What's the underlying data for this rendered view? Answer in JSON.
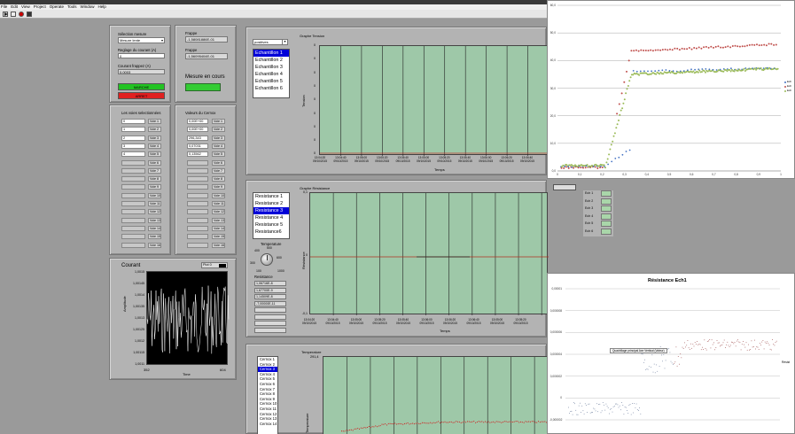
{
  "menu": [
    "File",
    "Edit",
    "View",
    "Project",
    "Operate",
    "Tools",
    "Window",
    "Help"
  ],
  "controls": {
    "selection_label": "Sélection mesure",
    "selection_value": "Mesure lente",
    "reglage_label": "Reglage du courant (A)",
    "reglage_value": "0",
    "courant_label": "Courant frappez (A)",
    "courant_value": "0,0003",
    "marche_label": "MARCHE",
    "arret_label": "ARRET",
    "frappe1_label": "Frappe",
    "frappe1_value": "-1,58081886E-01",
    "frappe2_label": "Frappe",
    "frappe2_value": "-1,56095404E-01",
    "mesure_label": "Mesure en cours"
  },
  "voies": {
    "title": "Les voies selectionnées",
    "rows": [
      {
        "num": "0",
        "name": "Voie 1"
      },
      {
        "num": "1",
        "name": "Voie 2"
      },
      {
        "num": "2",
        "name": "Voie 3"
      },
      {
        "num": "3",
        "name": "Voie 4"
      },
      {
        "num": "4",
        "name": "Voie 5"
      },
      {
        "num": "",
        "name": "Voie 6"
      },
      {
        "num": "",
        "name": "Voie 7"
      },
      {
        "num": "",
        "name": "Voie 8"
      },
      {
        "num": "",
        "name": "Voie 9"
      },
      {
        "num": "",
        "name": "Voie 10"
      },
      {
        "num": "",
        "name": "Voie 11"
      },
      {
        "num": "",
        "name": "Voie 12"
      },
      {
        "num": "",
        "name": "Voie 13"
      },
      {
        "num": "",
        "name": "Voie 14"
      },
      {
        "num": "",
        "name": "Voie 15"
      },
      {
        "num": "",
        "name": "Voie 16"
      }
    ]
  },
  "cernox": {
    "title": "Valeurs du Cernox",
    "rows": [
      {
        "val": "0,00E+00",
        "name": "Voie 1"
      },
      {
        "val": "0,00E+00",
        "name": "Voie 2"
      },
      {
        "val": "296,343",
        "name": "Voie 3"
      },
      {
        "val": "0,07031",
        "name": "Voie 4"
      },
      {
        "val": "0,13562",
        "name": "Voie 5"
      },
      {
        "val": "",
        "name": "Voie 6"
      },
      {
        "val": "",
        "name": "Voie 7"
      },
      {
        "val": "",
        "name": "Voie 8"
      },
      {
        "val": "",
        "name": "Voie 9"
      },
      {
        "val": "",
        "name": "Voie 10"
      },
      {
        "val": "",
        "name": "Voie 11"
      },
      {
        "val": "",
        "name": "Voie 12"
      },
      {
        "val": "",
        "name": "Voie 13"
      },
      {
        "val": "",
        "name": "Voie 14"
      },
      {
        "val": "",
        "name": "Voie 15"
      },
      {
        "val": "",
        "name": "Voie 16"
      }
    ]
  },
  "courant_chart": {
    "title": "Courant",
    "legend": "Plot 0",
    "ylabel": "Amplitude",
    "xlabel": "Time",
    "yticks": [
      "1,0015",
      "1,00145",
      "1,0014",
      "1,00135",
      "1,0013",
      "1,00125",
      "1,0012",
      "1,00115",
      "1,0011"
    ],
    "xticks": [
      "352",
      "604"
    ]
  },
  "temps_graph": {
    "title": "Graphe Tension",
    "selector_value": "positives",
    "ylabel": "Tension",
    "xlabel": "Temps",
    "yticks": [
      "0",
      "0",
      "0",
      "0",
      "0",
      "0",
      "0",
      "0",
      "0"
    ],
    "xticks": [
      "13:04:20\n09/10/2015",
      "13:04:40\n09/10/2015",
      "13:05:00\n09/10/2015",
      "13:05:20\n09/10/2015",
      "13:05:40\n09/10/2015",
      "13:05:00\n09/10/2015",
      "13:05:20\n09/10/2015",
      "13:05:40\n09/10/2015",
      "13:06:00\n09/10/2015",
      "13:06:20\n09/10/2015",
      "13:06:40\n09/10/2015"
    ],
    "items": [
      "Echantillon 1",
      "Echantillon 2",
      "Echantillon 3",
      "Echantillon 4",
      "Echantillon 5",
      "Echantillon 6"
    ],
    "selected": 0
  },
  "resist_graph": {
    "title": "Graphe Résistance",
    "ylabel": "Résistance",
    "xlabel": "Temps",
    "yticks": [
      "0,1",
      "0",
      "-0,1"
    ],
    "xticks": [
      "13:04:20\n09/10/2015",
      "13:04:40\n09/10/2015",
      "13:05:00\n09/10/2015",
      "13:05:20\n09/10/2015",
      "13:05:40\n09/10/2015",
      "13:06:00\n09/10/2015",
      "13:06:20\n09/10/2015",
      "13:06:40\n09/10/2015",
      "13:05:00\n09/10/2015",
      "13:05:20\n09/10/2015"
    ],
    "items": [
      "Resistance 1",
      "Resistance 2",
      "Resistance 3",
      "Resistance 4",
      "Resistance 5",
      "Resistance6"
    ],
    "selected": 2,
    "legend_items": [
      "Ech 1",
      "Ech 2",
      "Ech 3",
      "Ech 4",
      "Ech 5",
      "Ech 6"
    ]
  },
  "temp_knob": {
    "label": "Temperature",
    "ticks": [
      "300",
      "400",
      "500",
      "600",
      "100",
      "1000"
    ],
    "resistance_label": "Resistance",
    "values": [
      "1,06716E-8",
      "1,67700E-9",
      "1,14509E-8",
      "-7,00000E-11"
    ]
  },
  "temp_graph": {
    "title": "Temperature",
    "ylabel": "Temperature",
    "ytick_top": "291,4",
    "items": [
      "Cernox 1",
      "Cernox 2",
      "Cernox 3",
      "Cernox 4",
      "Cernox 5",
      "Cernox 6",
      "Cernox 7",
      "Cernox 8",
      "Cernox 9",
      "Cernox 10",
      "Cernox 11",
      "Cernox 12",
      "Cernox 13",
      "Cernox 14"
    ],
    "selected": 2
  },
  "excel_top": {
    "yticks": [
      "60,0",
      "50,0",
      "40,0",
      "30,0",
      "20,0",
      "10,0",
      "0,0"
    ],
    "xticks": [
      "0",
      "0,1",
      "0,2",
      "0,3",
      "0,4",
      "0,5",
      "0,6",
      "0,7",
      "0,8",
      "0,9",
      "1"
    ],
    "legend": [
      "Ech",
      "Ech",
      "Ech"
    ],
    "colors": [
      "#4472c4",
      "#c0504d",
      "#9bbb59"
    ]
  },
  "excel_bottom": {
    "title": "Résistance Ech1",
    "tooltip": "Quadrillage principal Axe Vertical (Valeur)",
    "axis_right": "Résist",
    "yticks": [
      "0,00001",
      "0,000008",
      "0,000006",
      "0,000004",
      "0,000002",
      "0",
      "-0,000002"
    ]
  }
}
